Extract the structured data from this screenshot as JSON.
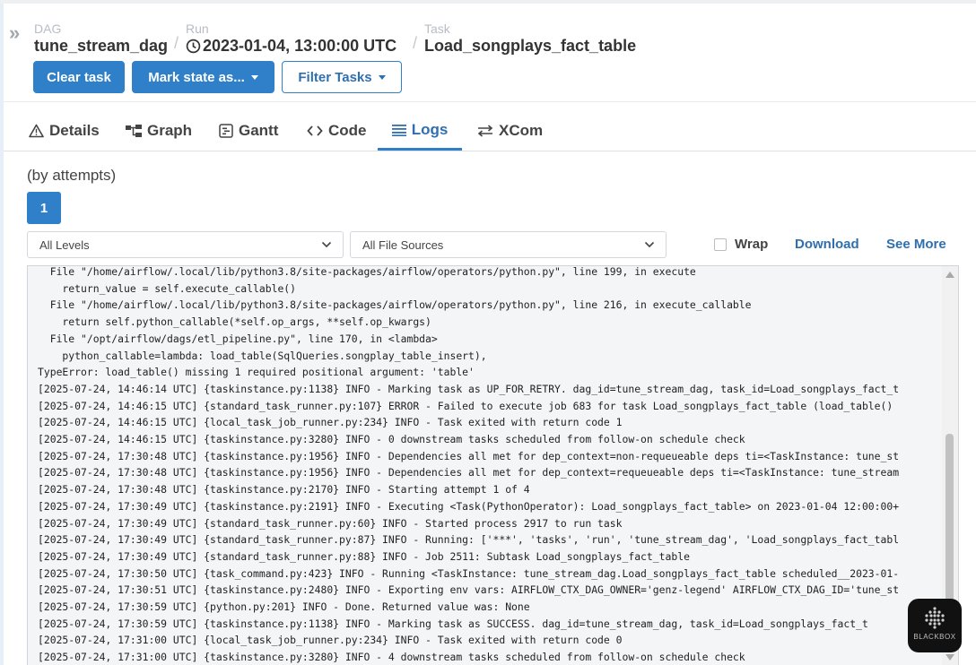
{
  "breadcrumb": {
    "dag": {
      "label": "DAG",
      "value": "tune_stream_dag"
    },
    "run": {
      "label": "Run",
      "value": "2023-01-04, 13:00:00 UTC"
    },
    "task": {
      "label": "Task",
      "value": "Load_songplays_fact_table"
    },
    "separator": "/"
  },
  "actions": {
    "clear_task": "Clear task",
    "mark_state": "Mark state as...",
    "filter_tasks": "Filter Tasks"
  },
  "tabs": [
    {
      "label": "Details",
      "icon": "warning-triangle-icon"
    },
    {
      "label": "Graph",
      "icon": "graph-icon"
    },
    {
      "label": "Gantt",
      "icon": "gantt-icon"
    },
    {
      "label": "Code",
      "icon": "code-icon"
    },
    {
      "label": "Logs",
      "icon": "list-icon",
      "active": true
    },
    {
      "label": "XCom",
      "icon": "exchange-icon"
    }
  ],
  "logs": {
    "attempts_label": "(by attempts)",
    "attempt": "1",
    "level_select": "All Levels",
    "source_select": "All File Sources",
    "wrap_label": "Wrap",
    "download_label": "Download",
    "see_more_label": "See More",
    "lines": [
      "  File \"/home/airflow/.local/lib/python3.8/site-packages/airflow/operators/python.py\", line 199, in execute",
      "    return_value = self.execute_callable()",
      "  File \"/home/airflow/.local/lib/python3.8/site-packages/airflow/operators/python.py\", line 216, in execute_callable",
      "    return self.python_callable(*self.op_args, **self.op_kwargs)",
      "  File \"/opt/airflow/dags/etl_pipeline.py\", line 170, in <lambda>",
      "    python_callable=lambda: load_table(SqlQueries.songplay_table_insert),",
      "TypeError: load_table() missing 1 required positional argument: 'table'",
      "[2025-07-24, 14:46:14 UTC] {taskinstance.py:1138} INFO - Marking task as UP_FOR_RETRY. dag_id=tune_stream_dag, task_id=Load_songplays_fact_t",
      "[2025-07-24, 14:46:15 UTC] {standard_task_runner.py:107} ERROR - Failed to execute job 683 for task Load_songplays_fact_table (load_table()",
      "[2025-07-24, 14:46:15 UTC] {local_task_job_runner.py:234} INFO - Task exited with return code 1",
      "[2025-07-24, 14:46:15 UTC] {taskinstance.py:3280} INFO - 0 downstream tasks scheduled from follow-on schedule check",
      "[2025-07-24, 17:30:48 UTC] {taskinstance.py:1956} INFO - Dependencies all met for dep_context=non-requeueable deps ti=<TaskInstance: tune_st",
      "[2025-07-24, 17:30:48 UTC] {taskinstance.py:1956} INFO - Dependencies all met for dep_context=requeueable deps ti=<TaskInstance: tune_stream",
      "[2025-07-24, 17:30:48 UTC] {taskinstance.py:2170} INFO - Starting attempt 1 of 4",
      "[2025-07-24, 17:30:49 UTC] {taskinstance.py:2191} INFO - Executing <Task(PythonOperator): Load_songplays_fact_table> on 2023-01-04 12:00:00+",
      "[2025-07-24, 17:30:49 UTC] {standard_task_runner.py:60} INFO - Started process 2917 to run task",
      "[2025-07-24, 17:30:49 UTC] {standard_task_runner.py:87} INFO - Running: ['***', 'tasks', 'run', 'tune_stream_dag', 'Load_songplays_fact_tabl",
      "[2025-07-24, 17:30:49 UTC] {standard_task_runner.py:88} INFO - Job 2511: Subtask Load_songplays_fact_table",
      "[2025-07-24, 17:30:50 UTC] {task_command.py:423} INFO - Running <TaskInstance: tune_stream_dag.Load_songplays_fact_table scheduled__2023-01-",
      "[2025-07-24, 17:30:51 UTC] {taskinstance.py:2480} INFO - Exporting env vars: AIRFLOW_CTX_DAG_OWNER='genz-legend' AIRFLOW_CTX_DAG_ID='tune_st",
      "[2025-07-24, 17:30:59 UTC] {python.py:201} INFO - Done. Returned value was: None",
      "[2025-07-24, 17:30:59 UTC] {taskinstance.py:1138} INFO - Marking task as SUCCESS. dag_id=tune_stream_dag, task_id=Load_songplays_fact_t",
      "[2025-07-24, 17:31:00 UTC] {local_task_job_runner.py:234} INFO - Task exited with return code 0",
      "[2025-07-24, 17:31:00 UTC] {taskinstance.py:3280} INFO - 4 downstream tasks scheduled from follow-on schedule check"
    ]
  },
  "overlay": {
    "label": "BLACKBOX"
  },
  "colors": {
    "primary": "#2f80c8",
    "link": "#2f6fb0",
    "log_bg": "#f3f5f6"
  }
}
